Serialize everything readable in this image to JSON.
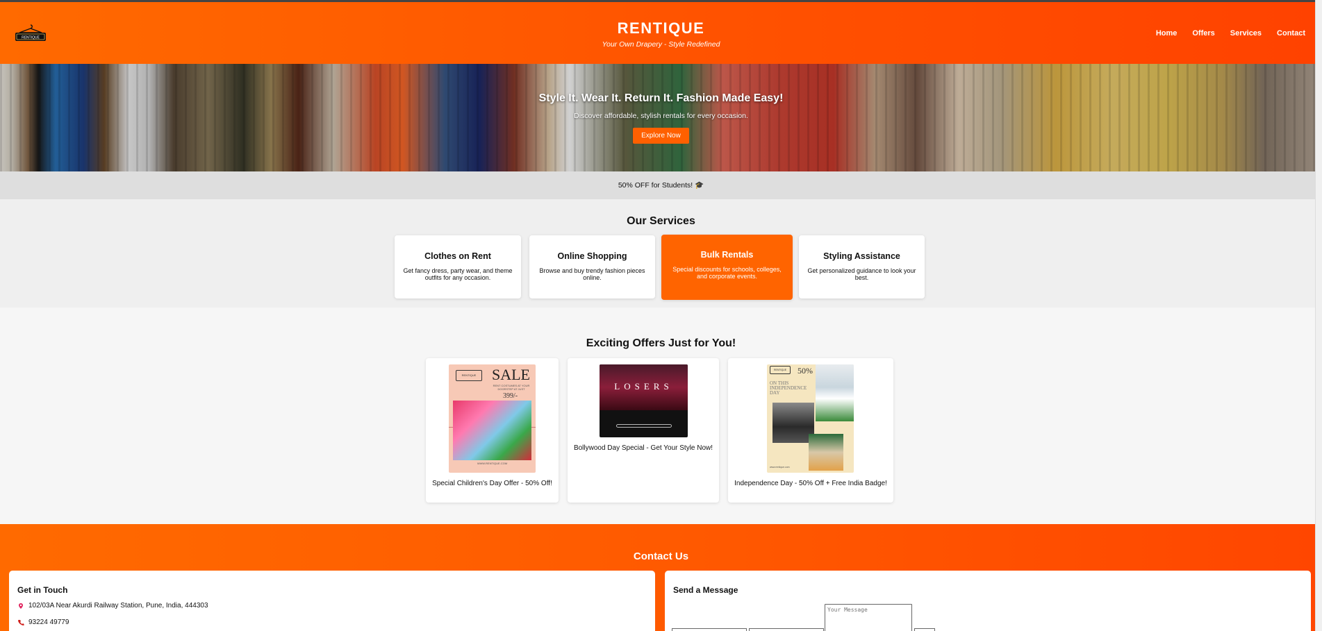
{
  "header": {
    "logo_text": "RENTIQUE",
    "title": "RENTIQUE",
    "tagline": "Your Own Drapery - Style Redefined",
    "nav": [
      "Home",
      "Offers",
      "Services",
      "Contact"
    ]
  },
  "hero": {
    "title": "Style It. Wear It. Return It. Fashion Made Easy!",
    "subtitle": "Discover affordable, stylish rentals for every occasion.",
    "button": "Explore Now"
  },
  "promo_strip": {
    "text": "50% OFF for Students! 🎓"
  },
  "services": {
    "title": "Our Services",
    "cards": [
      {
        "title": "Clothes on Rent",
        "desc": "Get fancy dress, party wear, and theme outfits for any occasion."
      },
      {
        "title": "Online Shopping",
        "desc": "Browse and buy trendy fashion pieces online."
      },
      {
        "title": "Bulk Rentals",
        "desc": "Special discounts for schools, colleges, and corporate events."
      },
      {
        "title": "Styling Assistance",
        "desc": "Get personalized guidance to look your best."
      }
    ]
  },
  "offers": {
    "title": "Exciting Offers Just for You!",
    "cards": [
      {
        "caption": "Special Children's Day Offer - 50% Off!",
        "art": {
          "sale": "SALE",
          "fine": "RENT COSTUMES AT YOUR DOORSTEP AT JUST",
          "price": "399/-",
          "logo": "RENTIQUE",
          "url": "WWW.RENTIQUE.COM"
        }
      },
      {
        "caption": "Bollywood Day Special - Get Your Style Now!",
        "art": {
          "letters": "LOSERS"
        }
      },
      {
        "caption": "Independence Day - 50% Off + Free India Badge!",
        "art": {
          "pct": "50%",
          "heading": "ON THIS INDEPENDENCE DAY",
          "logo": "RENTIQUE",
          "url": "www.rentique.com"
        }
      }
    ]
  },
  "contact": {
    "title": "Contact Us",
    "left": {
      "heading": "Get in Touch",
      "address": "102/03A Near Akurdi Railway Station, Pune, India, 444303",
      "phone": "93224 49779"
    },
    "right": {
      "heading": "Send a Message",
      "message_placeholder": "Your Message"
    }
  },
  "colors": {
    "accent": "#ff6000",
    "header": "#ff5a00",
    "card": "#ffffff"
  }
}
